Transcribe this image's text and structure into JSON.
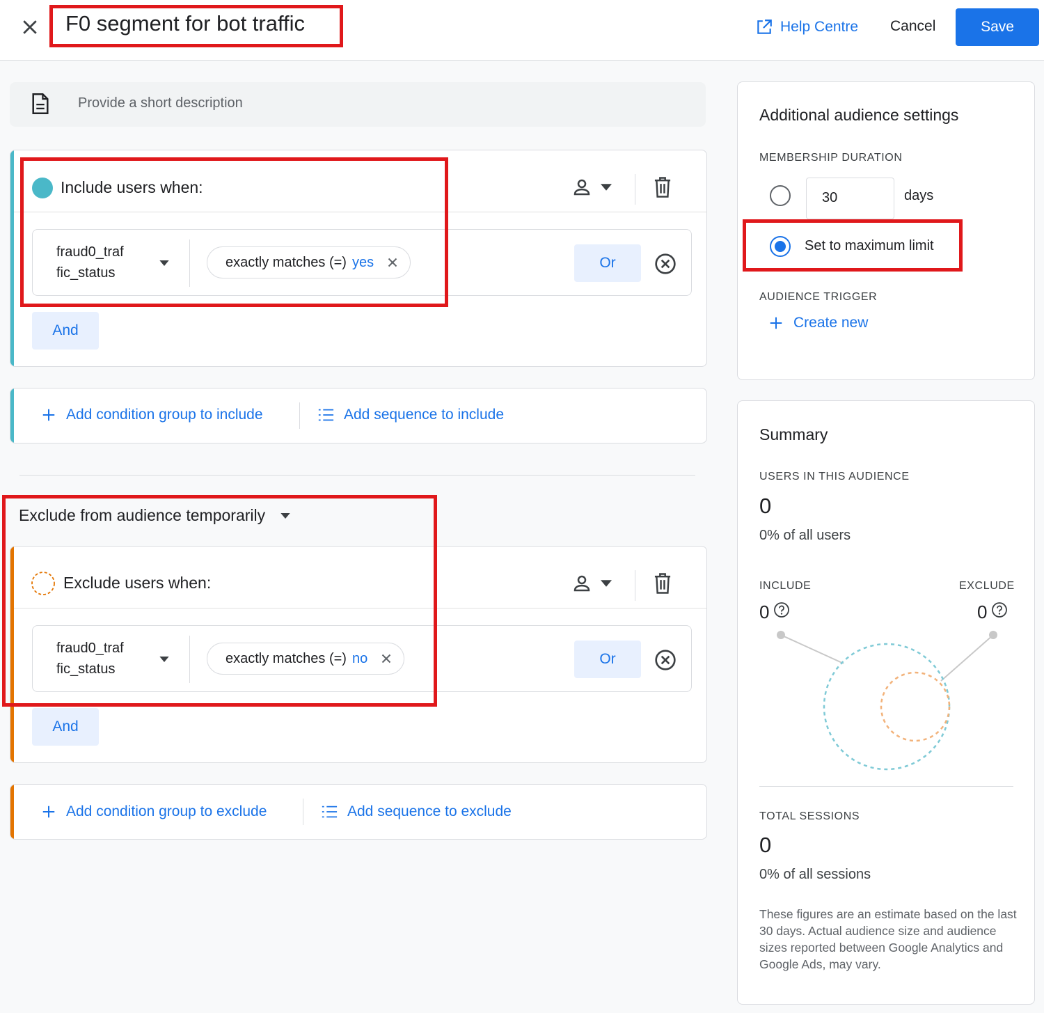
{
  "header": {
    "title": "F0 segment for bot traffic",
    "help_label": "Help Centre",
    "cancel_label": "Cancel",
    "save_label": "Save"
  },
  "description": {
    "placeholder": "Provide a short description"
  },
  "include_group": {
    "heading": "Include users when:",
    "condition": {
      "dimension_line1": "fraud0_traf",
      "dimension_line2": "fic_status",
      "operator": "exactly matches (=)",
      "value": "yes"
    },
    "or_label": "Or",
    "and_label": "And"
  },
  "include_actions": {
    "add_group": "Add condition group to include",
    "add_sequence": "Add sequence to include"
  },
  "exclude_mode": {
    "selected": "Exclude from audience temporarily"
  },
  "exclude_group": {
    "heading": "Exclude users when:",
    "condition": {
      "dimension_line1": "fraud0_traf",
      "dimension_line2": "fic_status",
      "operator": "exactly matches (=)",
      "value": "no"
    },
    "or_label": "Or",
    "and_label": "And"
  },
  "exclude_actions": {
    "add_group": "Add condition group to exclude",
    "add_sequence": "Add sequence to exclude"
  },
  "settings": {
    "title": "Additional audience settings",
    "membership_label": "MEMBERSHIP DURATION",
    "days_value": "30",
    "days_unit": "days",
    "max_limit_label": "Set to maximum limit",
    "max_limit_selected": true,
    "trigger_label": "AUDIENCE TRIGGER",
    "create_new": "Create new"
  },
  "summary": {
    "title": "Summary",
    "users_label": "USERS IN THIS AUDIENCE",
    "users_value": "0",
    "users_pct": "0% of all users",
    "include_label": "INCLUDE",
    "include_value": "0",
    "exclude_label": "EXCLUDE",
    "exclude_value": "0",
    "sessions_label": "TOTAL SESSIONS",
    "sessions_value": "0",
    "sessions_pct": "0% of all sessions",
    "note": "These figures are an estimate based on the last 30 days. Actual audience size and audience sizes reported between Google Analytics and Google Ads, may vary."
  },
  "colors": {
    "accent": "#1a73e8",
    "include": "#4ab8c8",
    "exclude": "#e37400",
    "highlight": "#e0181b"
  }
}
